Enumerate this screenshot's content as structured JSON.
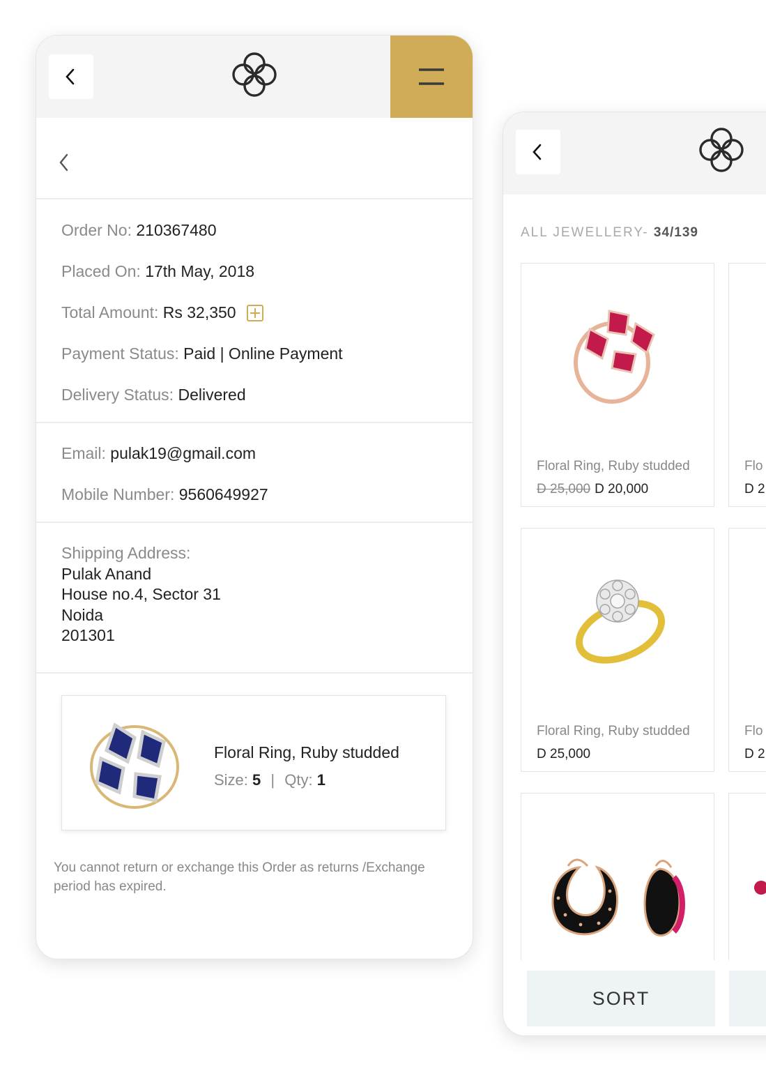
{
  "order_screen": {
    "order_no": {
      "label": "Order No:",
      "value": "210367480"
    },
    "placed_on": {
      "label": "Placed On:",
      "value": "17th May, 2018"
    },
    "total_amount": {
      "label": "Total Amount:",
      "value": "Rs 32,350"
    },
    "payment_status": {
      "label": "Payment Status:",
      "value": "Paid | Online Payment"
    },
    "delivery_status": {
      "label": "Delivery Status:",
      "value": "Delivered"
    },
    "email": {
      "label": "Email:",
      "value": "pulak19@gmail.com"
    },
    "mobile": {
      "label": "Mobile Number:",
      "value": "9560649927"
    },
    "shipping": {
      "label": "Shipping Address:",
      "lines": [
        "Pulak Anand",
        "House no.4, Sector 31",
        "Noida",
        "201301"
      ]
    },
    "item": {
      "name": "Floral Ring, Ruby studded",
      "size_label": "Size:",
      "size": "5",
      "separator": "|",
      "qty_label": "Qty:",
      "qty": "1"
    },
    "note": "You cannot return or exchange this Order as returns /Exchange period has expired."
  },
  "listing_screen": {
    "title": "ALL JEWELLERY-",
    "count": "34/139",
    "products": [
      {
        "name": "Floral Ring, Ruby studded",
        "old_price": "D 25,000",
        "price": "D 20,000"
      },
      {
        "name": "Flo",
        "price": "D 2"
      },
      {
        "name": "Floral Ring, Ruby studded",
        "price": "D 25,000"
      },
      {
        "name": "Flo",
        "price": "D 2"
      }
    ],
    "sort_label": "SORT"
  },
  "colors": {
    "accent_gold": "#d0ab58",
    "topbar_bg": "#f4f4f4",
    "button_bg": "#eef3f6"
  },
  "icons": [
    "chevron-left-icon",
    "quatrefoil-logo-icon",
    "hamburger-menu-icon",
    "plus-square-icon"
  ]
}
